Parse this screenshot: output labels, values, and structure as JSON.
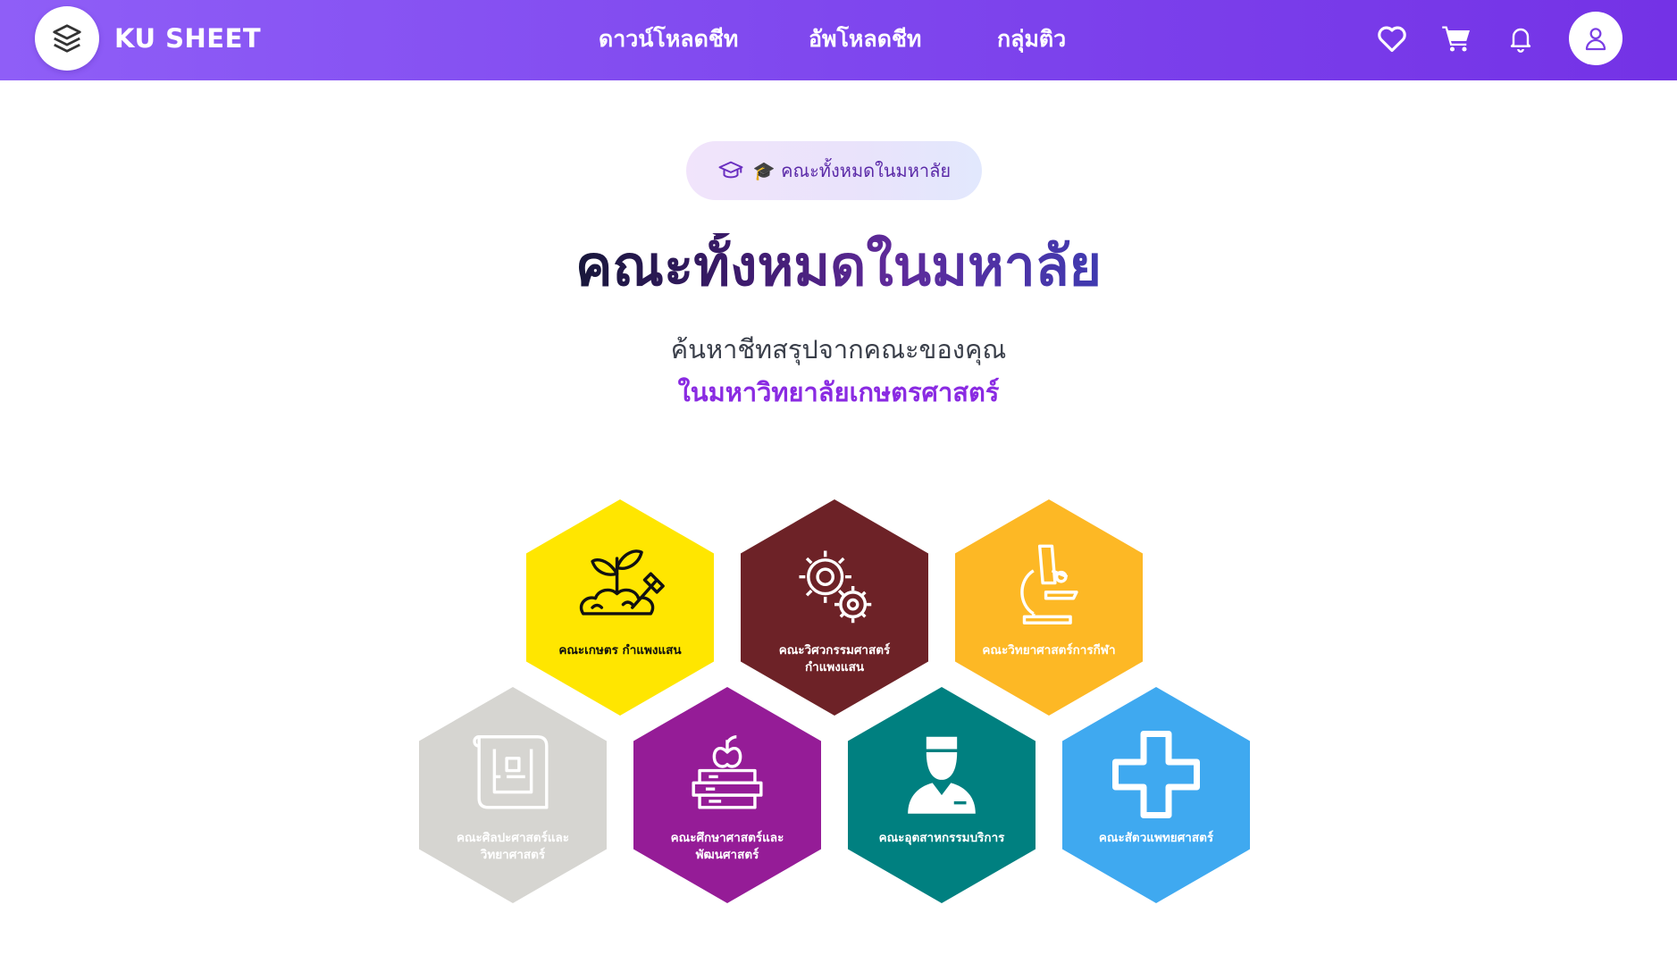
{
  "header": {
    "brand": "KU SHEET",
    "nav": [
      {
        "label": "ดาวน์โหลดชีท"
      },
      {
        "label": "อัพโหลดชีท"
      },
      {
        "label": "กลุ่มติว"
      }
    ],
    "icons": [
      "heart-icon",
      "cart-icon",
      "bell-icon",
      "user-icon"
    ]
  },
  "hero": {
    "badge": "🎓 คณะทั้งหมดในมหาลัย",
    "title": "คณะทั้งหมดในมหาลัย",
    "subtitle": "ค้นหาชีทสรุปจากคณะของคุณ",
    "subtitle_highlight": "ในมหาวิทยาลัยเกษตรศาสตร์"
  },
  "faculties": [
    {
      "line1": "คณะเกษตร กำแพงแสน",
      "line2": "",
      "color": "#ffe600",
      "icon": "plant-shovel-icon"
    },
    {
      "line1": "คณะวิศวกรรมศาสตร์",
      "line2": "กำแพงแสน",
      "color": "#6d2227",
      "icon": "gears-icon"
    },
    {
      "line1": "คณะวิทยาศาสตร์การกีฬา",
      "line2": "",
      "color": "#fdb825",
      "icon": "microscope-icon"
    },
    {
      "line1": "คณะศิลปะศาสตร์และ",
      "line2": "วิทยาศาสตร์",
      "color": "#d6d5d1",
      "icon": "blueprint-icon"
    },
    {
      "line1": "คณะศึกษาศาสตร์และ",
      "line2": "พัฒนศาสตร์",
      "color": "#951c97",
      "icon": "books-apple-icon"
    },
    {
      "line1": "คณะอุตสาหกรรมบริการ",
      "line2": "",
      "color": "#008080",
      "icon": "waiter-icon"
    },
    {
      "line1": "คณะสัตวแพทยศาสตร์",
      "line2": "",
      "color": "#3fa9f0",
      "icon": "medical-cross-icon"
    }
  ]
}
